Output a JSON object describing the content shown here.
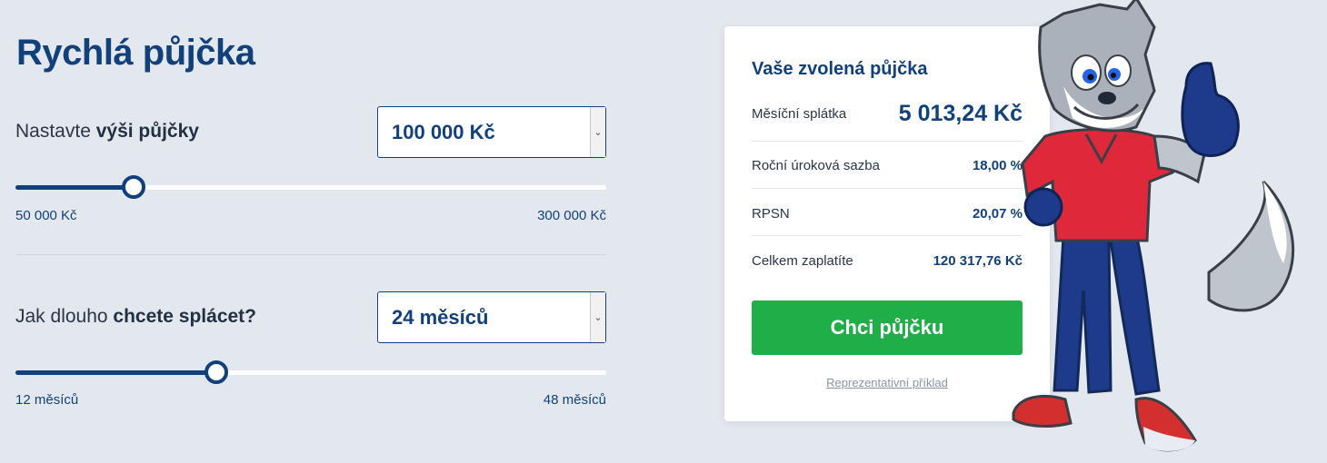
{
  "title": "Rychlá půjčka",
  "amount": {
    "label_prefix": "Nastavte ",
    "label_bold": "výši půjčky",
    "selected": "100 000 Kč",
    "min_label": "50 000 Kč",
    "max_label": "300 000 Kč",
    "slider_fraction": 0.2
  },
  "term": {
    "label_prefix": "Jak dlouho ",
    "label_bold": "chcete splácet?",
    "selected": "24 měsíců",
    "min_label": "12 měsíců",
    "max_label": "48 měsíců",
    "slider_fraction": 0.34
  },
  "summary": {
    "title": "Vaše zvolená půjčka",
    "monthly_label": "Měsíční splátka",
    "monthly_value": "5 013,24 Kč",
    "rate_label": "Roční úroková sazba",
    "rate_value": "18,00 %",
    "rpsn_label": "RPSN",
    "rpsn_value": "20,07 %",
    "total_label": "Celkem zaplatíte",
    "total_value": "120 317,76 Kč",
    "cta_label": "Chci půjčku",
    "representative_link": "Reprezentativní příklad"
  },
  "colors": {
    "brand_blue": "#11407a",
    "cta_green": "#1fae48",
    "background": "#e3e8ef"
  },
  "icons": {
    "select_arrow": "chevron-down-icon",
    "mascot": "wolf-mascot-illustration"
  }
}
